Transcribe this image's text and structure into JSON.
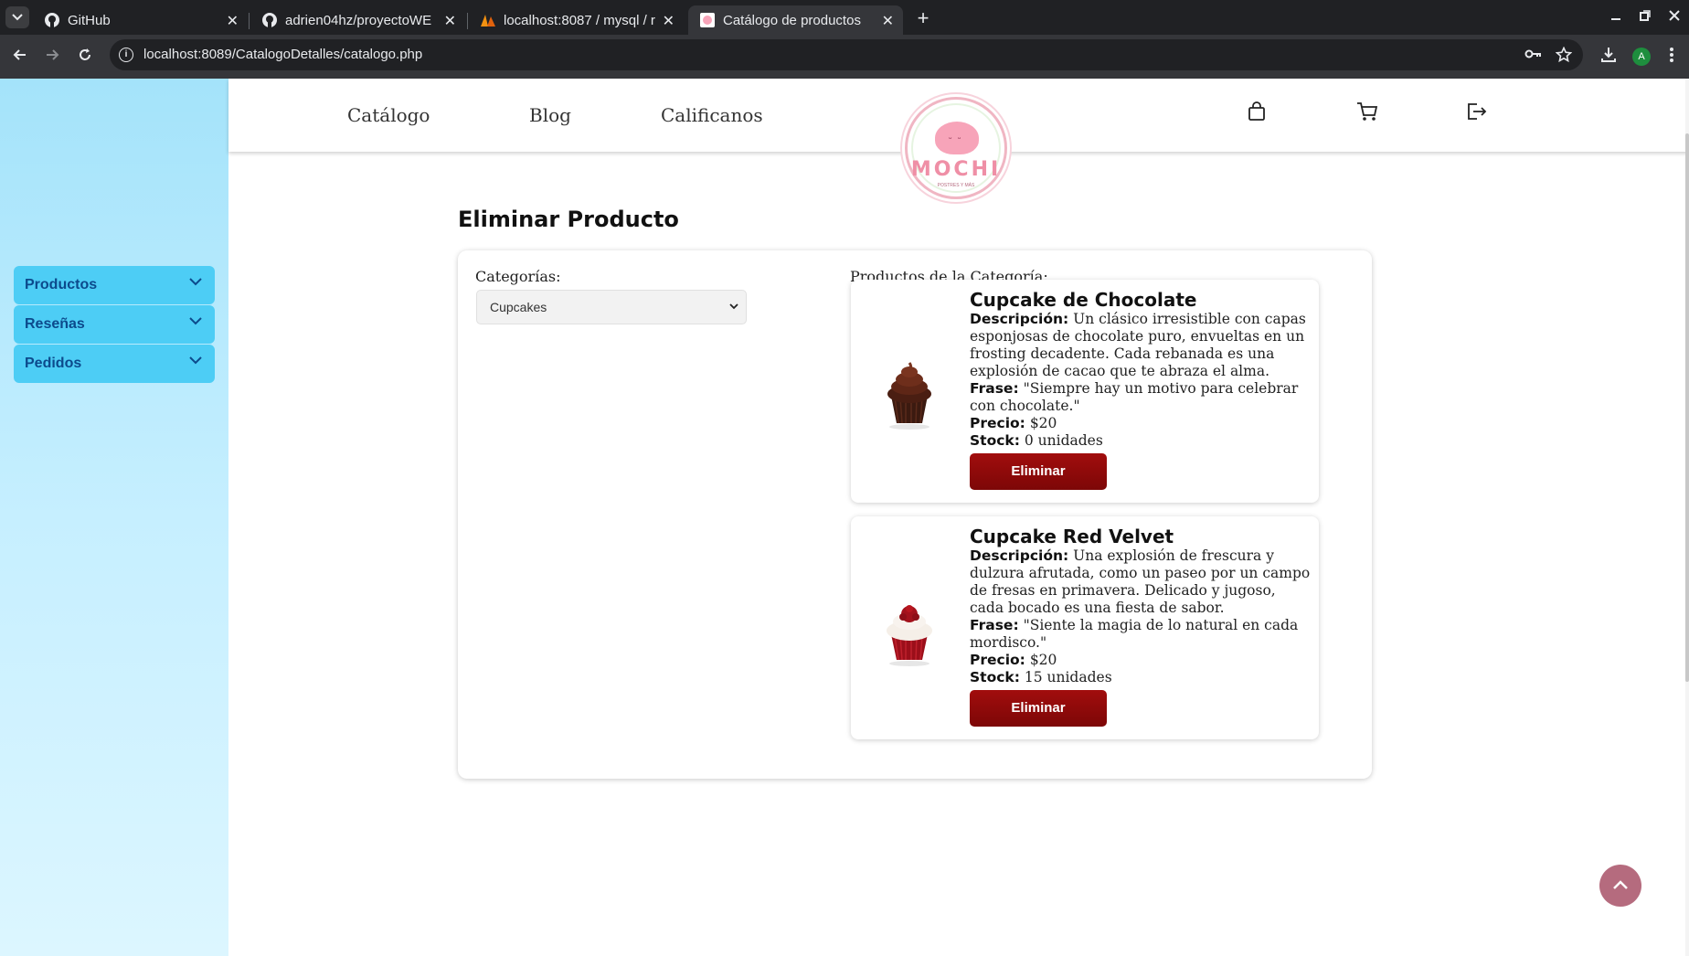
{
  "browser": {
    "tabs": [
      {
        "label": "GitHub",
        "icon": "github-icon"
      },
      {
        "label": "adrien04hz/proyectoWE",
        "icon": "github-icon"
      },
      {
        "label": "localhost:8087 / mysql / r",
        "icon": "phpmyadmin-icon"
      },
      {
        "label": "Catálogo de productos",
        "icon": "mochi-favicon-icon"
      }
    ],
    "url": "localhost:8089/CatalogoDetalles/catalogo.php",
    "profile_initial": "A"
  },
  "sidebar": {
    "items": [
      {
        "label": "Productos"
      },
      {
        "label": "Reseñas"
      },
      {
        "label": "Pedidos"
      }
    ]
  },
  "nav": {
    "links": [
      "Catálogo",
      "Blog",
      "Calificanos"
    ],
    "icons": [
      "shopping-bag-icon",
      "cart-icon",
      "logout-icon"
    ]
  },
  "logo": {
    "text": "MOCHI",
    "sub": "POSTRES Y MÁS"
  },
  "page": {
    "title": "Eliminar Producto",
    "categories_label": "Categorías:",
    "selected_category": "Cupcakes",
    "products_label": "Productos de la Categoría:"
  },
  "labels": {
    "description": "Descripción:",
    "phrase": "Frase:",
    "price": "Precio:",
    "stock": "Stock:",
    "delete_button": "Eliminar"
  },
  "products": [
    {
      "name": "Cupcake de Chocolate",
      "description": "Un clásico irresistible con capas esponjosas de chocolate puro, envueltas en un frosting decadente. Cada rebanada es una explosión de cacao que te abraza el alma.",
      "phrase": "\"Siempre hay un motivo para celebrar con chocolate.\"",
      "price": "$20",
      "stock": "0 unidades"
    },
    {
      "name": "Cupcake Red Velvet",
      "description": "Una explosión de frescura y dulzura afrutada, como un paseo por un campo de fresas en primavera. Delicado y jugoso, cada bocado es una fiesta de sabor.",
      "phrase": "\"Siente la magia de lo natural en cada mordisco.\"",
      "price": "$20",
      "stock": "15 unidades"
    }
  ],
  "colors": {
    "sidebar_item": "#4dcdf5",
    "delete_button": "#8b0a0a",
    "back_to_top": "#b56b7e"
  }
}
